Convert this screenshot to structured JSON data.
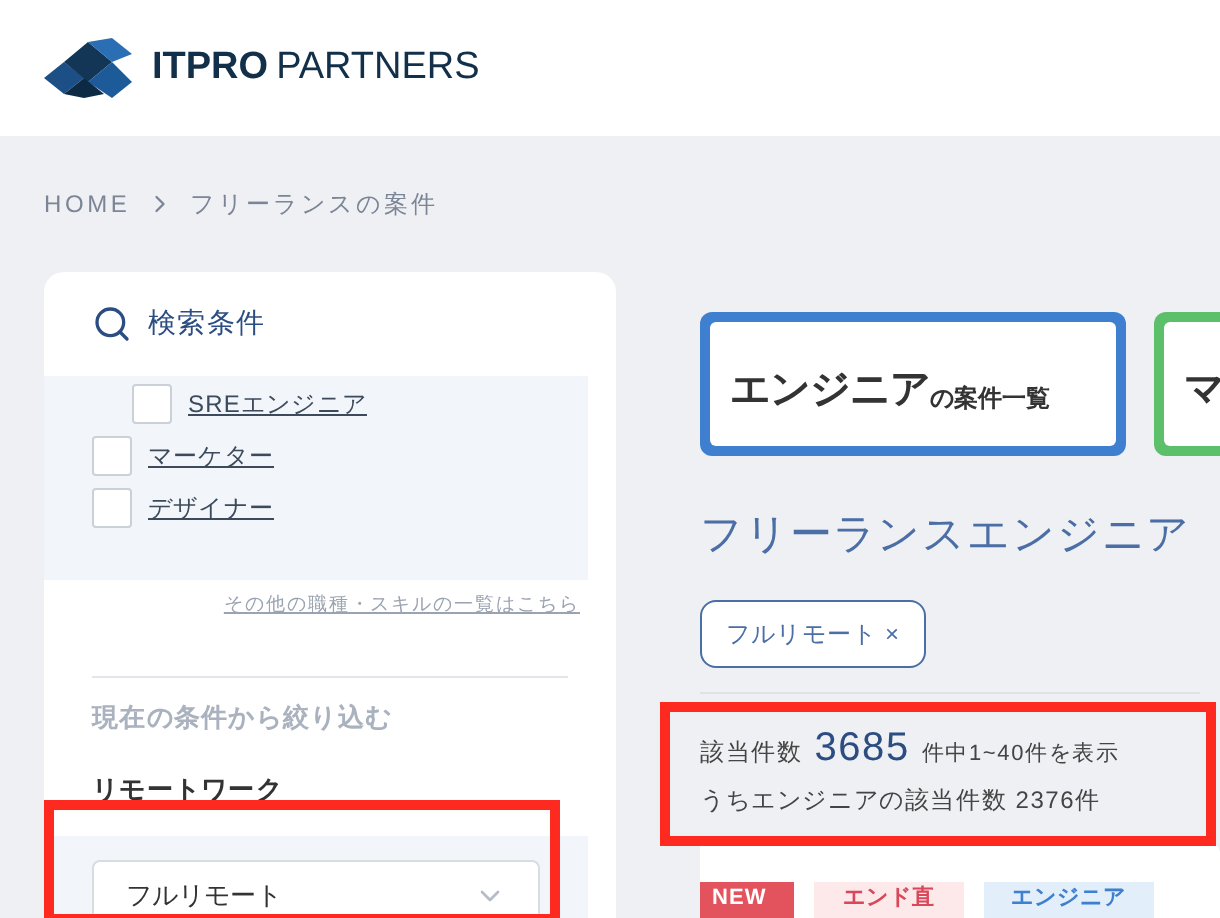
{
  "header": {
    "logo_bold": "ITPRO",
    "logo_light": "PARTNERS"
  },
  "breadcrumb": [
    "HOME",
    "フリーランスの案件"
  ],
  "sidebar": {
    "title": "検索条件",
    "job_types": [
      {
        "label": "SREエンジニア",
        "checked": false,
        "kind": "sub"
      },
      {
        "label": "マーケター",
        "checked": false,
        "kind": "top"
      },
      {
        "label": "デザイナー",
        "checked": false,
        "kind": "top"
      }
    ],
    "more_link": "その他の職種・スキルの一覧はこちら",
    "refine_heading": "現在の条件から絞り込む",
    "remote_label": "リモートワーク",
    "remote_select": {
      "value": "フルリモート"
    }
  },
  "main": {
    "categories": [
      {
        "title": "エンジニア",
        "suffix": "の案件一覧",
        "color": "#3f7fd0"
      },
      {
        "title": "マ",
        "color": "#5cbf6a"
      }
    ],
    "heading": "フリーランスエンジニア",
    "chips": [
      {
        "label": "フルリモート ×"
      }
    ],
    "result": {
      "label": "該当件数",
      "count": "3685",
      "range": "件中1~40件を表示",
      "sub": "うちエンジニアの該当件数 2376件"
    },
    "tags": [
      {
        "label": "NEW",
        "color": "#e2535e"
      },
      {
        "label": "エンド直",
        "color": "#fde8ea"
      },
      {
        "label": "エンジニア",
        "color": "#e2eefa"
      }
    ]
  }
}
